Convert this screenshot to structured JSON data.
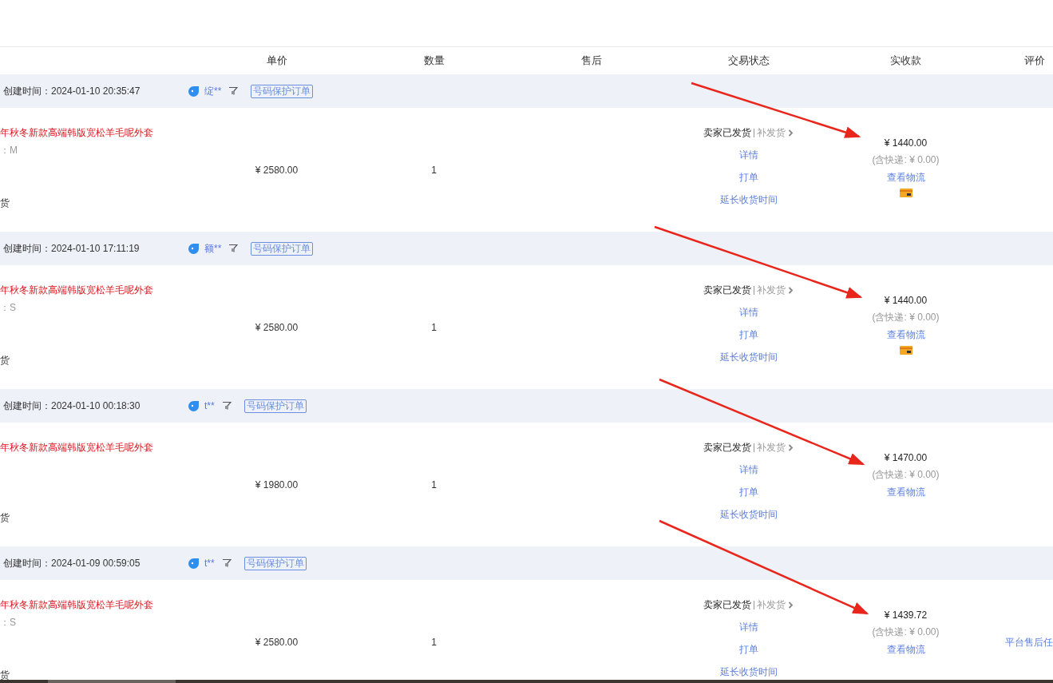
{
  "columns": [
    {
      "label": "单价"
    },
    {
      "label": "数量"
    },
    {
      "label": "售后"
    },
    {
      "label": "交易状态"
    },
    {
      "label": "实收款"
    },
    {
      "label": "评价"
    }
  ],
  "orders": [
    {
      "created": "创建时间：2024-01-10 20:35:47",
      "buyer": "绽**",
      "tag": "号码保护订单",
      "title": "年秋冬新款高端韩版宽松羊毛呢外套",
      "sku": "：M",
      "note": "货",
      "price": "¥ 2580.00",
      "quantity": "1",
      "status": "卖家已发货",
      "status_link": "补发货",
      "actions": [
        "详情",
        "打单",
        "延长收货时间"
      ],
      "paid": "¥ 1440.00",
      "shipping": "(含快递: ¥ 0.00)",
      "logistics": "查看物流",
      "payment_icon": true
    },
    {
      "created": "创建时间：2024-01-10 17:11:19",
      "buyer": "额**",
      "tag": "号码保护订单",
      "title": "年秋冬新款高端韩版宽松羊毛呢外套",
      "sku": "：S",
      "note": "货",
      "price": "¥ 2580.00",
      "quantity": "1",
      "status": "卖家已发货",
      "status_link": "补发货",
      "actions": [
        "详情",
        "打单",
        "延长收货时间"
      ],
      "paid": "¥ 1440.00",
      "shipping": "(含快递: ¥ 0.00)",
      "logistics": "查看物流",
      "payment_icon": true
    },
    {
      "created": "创建时间：2024-01-10 00:18:30",
      "buyer": "t**",
      "tag": "号码保护订单",
      "title": "年秋冬新款高端韩版宽松羊毛呢外套",
      "note": "货",
      "price": "¥ 1980.00",
      "quantity": "1",
      "status": "卖家已发货",
      "status_link": "补发货",
      "actions": [
        "详情",
        "打单",
        "延长收货时间"
      ],
      "paid": "¥ 1470.00",
      "shipping": "(含快递: ¥ 0.00)",
      "logistics": "查看物流",
      "payment_icon": false
    },
    {
      "created": "创建时间：2024-01-09 00:59:05",
      "buyer": "t**",
      "tag": "号码保护订单",
      "title": "年秋冬新款高端韩版宽松羊毛呢外套",
      "sku": "：S",
      "note": "货",
      "price": "¥ 2580.00",
      "quantity": "1",
      "status": "卖家已发货",
      "status_link": "补发货",
      "actions": [
        "详情",
        "打单",
        "延长收货时间"
      ],
      "paid": "¥ 1439.72",
      "shipping": "(含快递: ¥ 0.00)",
      "logistics": "查看物流",
      "payment_icon": false,
      "review": "平台售后任"
    }
  ]
}
